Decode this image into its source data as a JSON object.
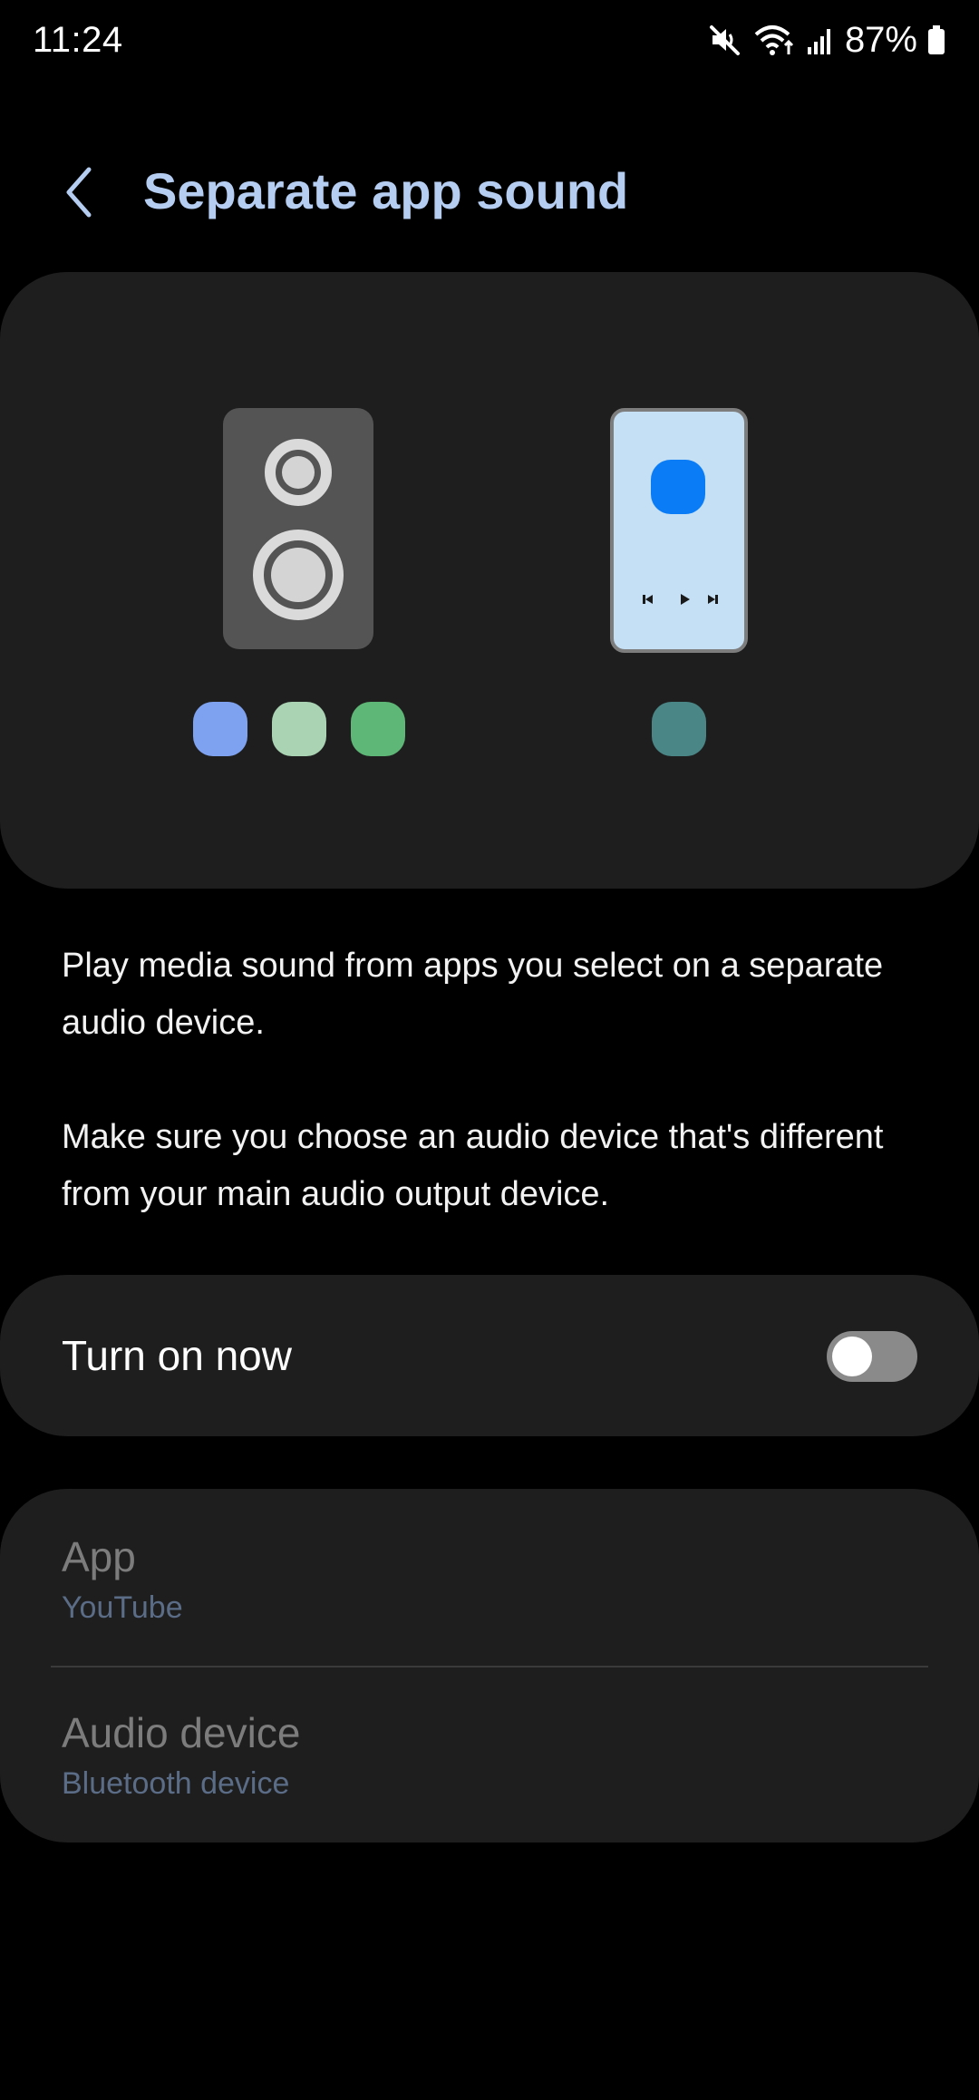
{
  "status_bar": {
    "time": "11:24",
    "battery_percent": "87%",
    "icons": [
      "mute-icon",
      "wifi-icon",
      "signal-icon",
      "battery-icon"
    ]
  },
  "header": {
    "back_icon": "chevron-left-icon",
    "title": "Separate app sound"
  },
  "illustration": {
    "speaker_dots": [
      "#7fa2f0",
      "#a9d3b3",
      "#5fb777"
    ],
    "phone_dot": "#4a8686",
    "phone_app_color": "#0a7cf6",
    "phone_screen_color": "#c5e0f4"
  },
  "description": {
    "paragraph1": "Play media sound from apps you select on a separate audio device.",
    "paragraph2": "Make sure you choose an audio device that's different from your main audio output device."
  },
  "toggle": {
    "label": "Turn on now",
    "state": "off"
  },
  "settings": {
    "app_title": "App",
    "app_value": "YouTube",
    "audio_title": "Audio device",
    "audio_value": "Bluetooth device"
  },
  "colors": {
    "title_accent": "#b5cdf1",
    "card_bg": "#1e1e1e",
    "subtitle": "#5b6c87"
  }
}
